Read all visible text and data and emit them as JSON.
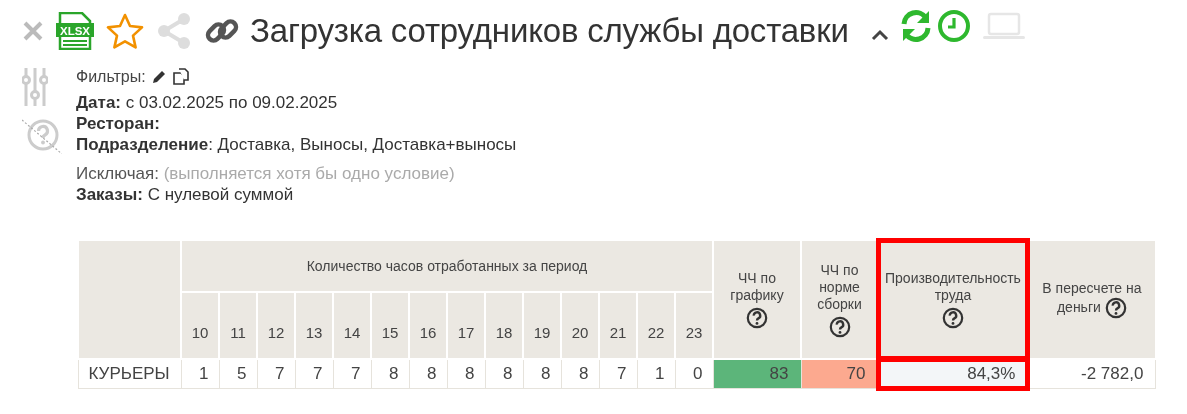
{
  "toolbar": {
    "export_format": "XLSX",
    "title": "Загрузка сотрудников службы доставки"
  },
  "filters": {
    "label": "Фильтры:",
    "lines": [
      {
        "text": "**Дата:** с 03.02.2025 по 09.02.2025"
      },
      {
        "text": "Ресторан:"
      },
      {
        "text": "**Подразделение**: Доставка, Выносы, Доставка+выносы"
      }
    ],
    "exclude": {
      "label": "Исключая:",
      "note": "(выполняется хотя бы одно условие)"
    },
    "exclude_lines": [
      {
        "text": "**Заказы:** С нулевой суммой"
      }
    ]
  },
  "table": {
    "group_header": "Количество часов отработанных за период",
    "hours": [
      "10",
      "11",
      "12",
      "13",
      "14",
      "15",
      "16",
      "17",
      "18",
      "19",
      "20",
      "21",
      "22",
      "23"
    ],
    "metric_columns": [
      {
        "label": "ЧЧ по графику",
        "kind": "stacked",
        "highlighted": false
      },
      {
        "label": "ЧЧ по норме сборки",
        "kind": "stacked",
        "highlighted": false
      },
      {
        "label": "Производительность труда",
        "kind": "stacked",
        "highlighted": true
      },
      {
        "label": "В пересчете на деньги",
        "kind": "inline",
        "highlighted": false
      }
    ],
    "rows": [
      {
        "label": "КУРЬЕРЫ",
        "hours": [
          "1",
          "5",
          "7",
          "7",
          "7",
          "8",
          "8",
          "8",
          "8",
          "8",
          "8",
          "7",
          "1",
          "0"
        ],
        "metrics": [
          {
            "value": "83",
            "color": "#5cb57a"
          },
          {
            "value": "70",
            "color": "#fca98f"
          },
          {
            "value": "84,3%",
            "color": "#f3f6f8"
          },
          {
            "value": "-2 782,0",
            "color": "#ffffff"
          }
        ]
      }
    ]
  }
}
